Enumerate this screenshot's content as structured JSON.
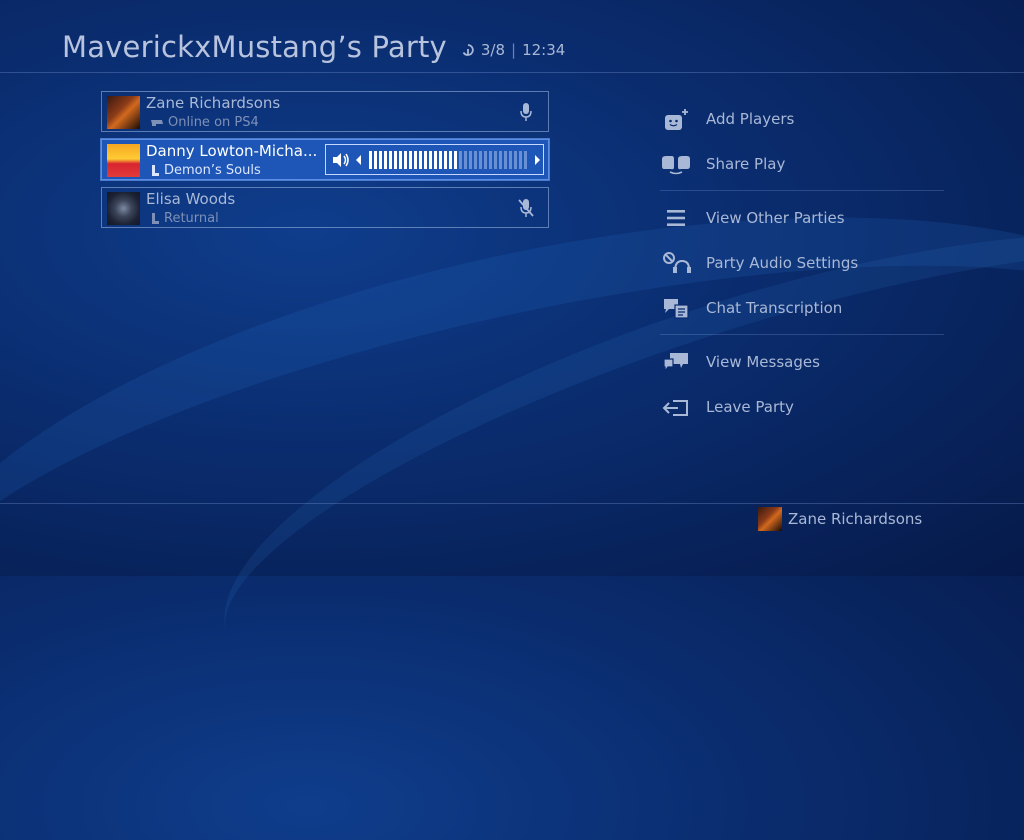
{
  "party": {
    "title": "MaverickxMustang’s Party",
    "count": "3/8",
    "time": "12:34"
  },
  "members": [
    {
      "name": "Zane Richardsons",
      "status": "Online on PS4",
      "status_icon": "ps4-console-icon",
      "audio": "mic-icon"
    },
    {
      "name": "Danny Lowton-Micha...",
      "status": "Demon’s Souls",
      "status_icon": "ps5-console-icon",
      "volume_level": 0.55
    },
    {
      "name": "Elisa Woods",
      "status": "Returnal",
      "status_icon": "ps5-console-icon",
      "audio": "mic-muted-icon"
    }
  ],
  "menu": {
    "add_players": "Add Players",
    "share_play": "Share Play",
    "view_other_parties": "View Other Parties",
    "party_audio_settings": "Party Audio Settings",
    "chat_transcription": "Chat Transcription",
    "view_messages": "View Messages",
    "leave_party": "Leave Party"
  },
  "footer": {
    "user": "Zane Richardsons"
  },
  "colors": {
    "accent": "#1d56b6",
    "text": "#a9b8d6"
  }
}
